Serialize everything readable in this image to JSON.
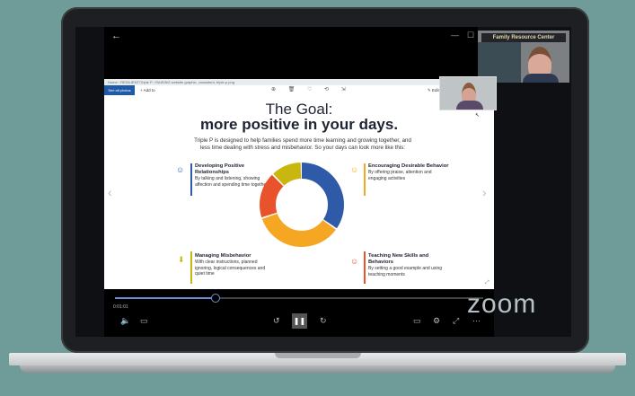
{
  "slide": {
    "title_line1": "The Goal:",
    "title_line2": "more positive in your days.",
    "subtitle": "Triple P is designed to help families spend more time learning and growing together, and less time dealing with stress and misbehavior. So your days can look more like this:",
    "blocks": [
      {
        "heading": "Developing Positive Relationships",
        "text": "By talking and listening, showing affection and spending time together",
        "color": "#2f5aa8"
      },
      {
        "heading": "Encouraging Desirable Behavior",
        "text": "By offering praise, attention and engaging activities",
        "color": "#f5a623"
      },
      {
        "heading": "Managing Misbehavior",
        "text": "With clear instructions, planned ignoring, logical consequences and quiet time",
        "color": "#c9b70f"
      },
      {
        "heading": "Teaching New Skills and Behaviors",
        "text": "By setting a good example and using teaching moments",
        "color": "#e8532b"
      }
    ],
    "donut_segments": [
      {
        "name": "positive-relationships",
        "color": "#2f5aa8",
        "share": 0.35
      },
      {
        "name": "desirable-behavior",
        "color": "#f5a623",
        "share": 0.35
      },
      {
        "name": "teaching-skills",
        "color": "#e8532b",
        "share": 0.18
      },
      {
        "name": "managing-misbehavior",
        "color": "#c9b70f",
        "share": 0.12
      }
    ]
  },
  "browser": {
    "url": "Home › RESILIENT/Triple P › RAISING website graphic, consistent, triple-p.png",
    "toolbar_button": "See all photos",
    "add_to": "Add to",
    "edit_create": "Edit & Create"
  },
  "video": {
    "current_time": "0:01:01",
    "progress": 0.27
  },
  "thumbnail": {
    "sign_text": "Family Resource Center"
  },
  "watermark": "zoom"
}
